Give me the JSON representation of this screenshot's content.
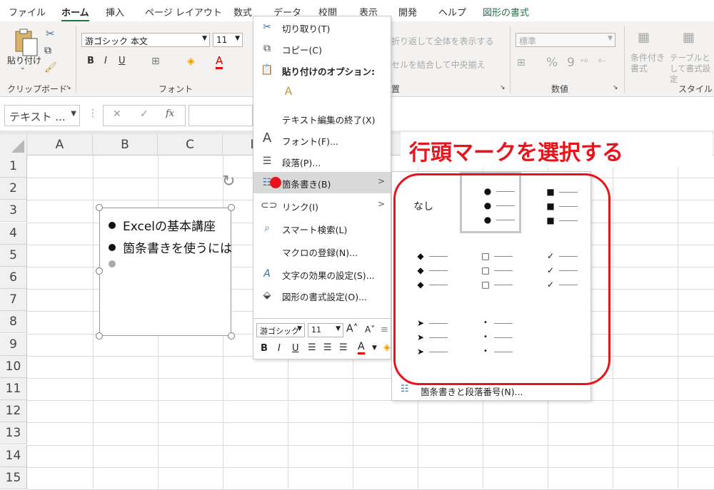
{
  "tabs": [
    "ファイル",
    "ホーム",
    "挿入",
    "ページ レイアウト",
    "数式",
    "データ",
    "校閲",
    "表示",
    "開発",
    "ヘルプ",
    "図形の書式"
  ],
  "ribbon": {
    "paste_label": "貼り付け",
    "clipboard_label": "クリップボード",
    "font_group_label": "フォント",
    "font_name": "游ゴシック 本文",
    "font_size": "11",
    "wrap_text": "折り返して全体を表示する",
    "merge_center": "セルを結合して中央揃え",
    "align_group_label": "置",
    "number_format": "標準",
    "number_group_label": "数値",
    "percent": "%",
    "comma": "9",
    "cond_format": "条件付き書式",
    "table_format": "テーブルとして書式設定",
    "styles_group_label": "スタイル",
    "bold": "B",
    "italic": "I",
    "underline": "U"
  },
  "formula_bar": {
    "name_box": "テキスト ...",
    "cancel": "✕",
    "enter": "✓",
    "fx": "fx"
  },
  "grid": {
    "columns": [
      "A",
      "B",
      "C",
      "D"
    ],
    "rows": [
      "1",
      "2",
      "3",
      "4",
      "5",
      "6",
      "7",
      "8",
      "9",
      "10",
      "11",
      "12",
      "13",
      "14",
      "15"
    ]
  },
  "shape": {
    "lines": [
      "Excelの基本講座",
      "箇条書きを使うには"
    ]
  },
  "context_menu": {
    "items": [
      {
        "label": "切り取り(T)",
        "icon": "scissors-icon"
      },
      {
        "label": "コピー(C)",
        "icon": "copy-icon"
      },
      {
        "label": "貼り付けのオプション:",
        "icon": "paste-icon"
      },
      {
        "label": "テキスト編集の終了(X)",
        "icon": ""
      },
      {
        "label": "フォント(F)...",
        "icon": "font-icon"
      },
      {
        "label": "段落(P)...",
        "icon": "paragraph-icon"
      },
      {
        "label": "箇条書き(B)",
        "icon": "bullets-icon"
      },
      {
        "label": "リンク(I)",
        "icon": "link-icon"
      },
      {
        "label": "スマート検索(L)",
        "icon": "search-icon"
      },
      {
        "label": "マクロの登録(N)...",
        "icon": ""
      },
      {
        "label": "文字の効果の設定(S)...",
        "icon": "text-effects-icon"
      },
      {
        "label": "図形の書式設定(O)...",
        "icon": "format-shape-icon"
      }
    ],
    "submenu_arrow": ">"
  },
  "mini_toolbar": {
    "font": "游ゴシック",
    "size": "11",
    "bold": "B",
    "italic": "I",
    "underline": "U",
    "font_color_letter": "A"
  },
  "bullet_submenu": {
    "none_label": "なし",
    "options": [
      {
        "symbol": "",
        "kind": "none"
      },
      {
        "symbol": "●",
        "kind": "filled-round"
      },
      {
        "symbol": "■",
        "kind": "filled-square"
      },
      {
        "symbol": "◆",
        "kind": "diamond"
      },
      {
        "symbol": "□",
        "kind": "hollow-square"
      },
      {
        "symbol": "✓",
        "kind": "checkmark"
      },
      {
        "symbol": "➤",
        "kind": "arrowhead"
      },
      {
        "symbol": "•",
        "kind": "small-dot"
      }
    ],
    "footer_label": "箇条書きと段落番号(N)..."
  },
  "callout": "行頭マークを選択する",
  "colors": {
    "accent_green": "#217346",
    "callout_red": "#e8131b"
  }
}
